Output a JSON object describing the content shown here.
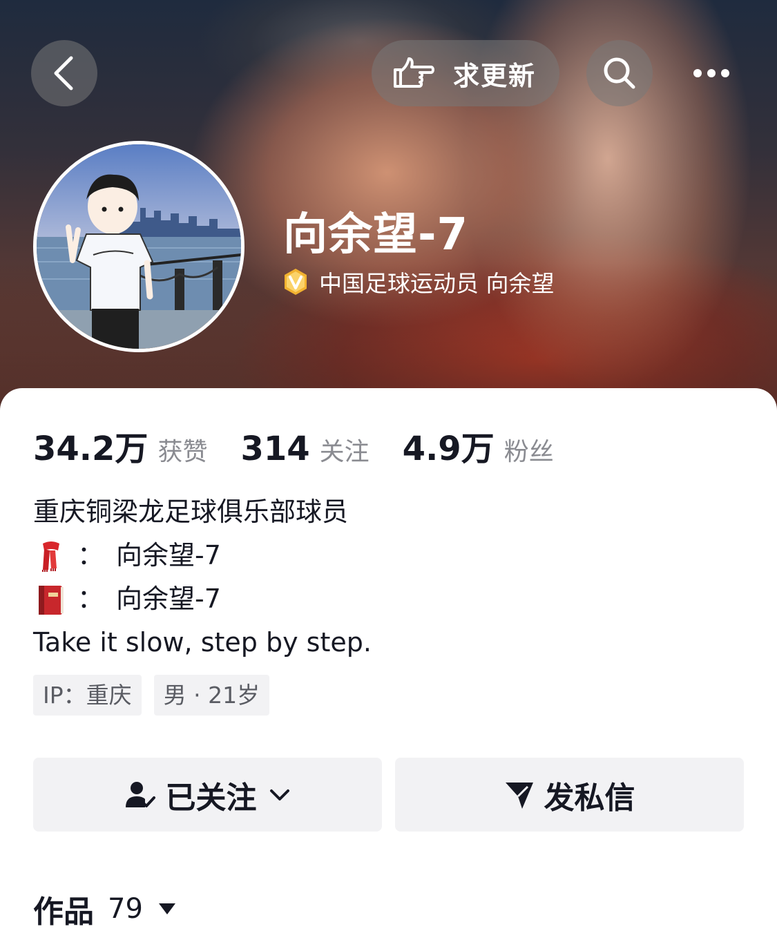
{
  "header": {
    "update_label": "求更新",
    "nickname": "向余望-7",
    "verify_text": "中国足球运动员 向余望",
    "verify_badge": "V"
  },
  "stats": [
    {
      "num": "34.2万",
      "label": "获赞"
    },
    {
      "num": "314",
      "label": "关注"
    },
    {
      "num": "4.9万",
      "label": "粉丝"
    }
  ],
  "bio": {
    "line1": "重庆铜梁龙足球俱乐部球员",
    "line2_colon": "：",
    "line2_text": "向余望-7",
    "line3_colon": "：",
    "line3_text": "向余望-7",
    "line4": "Take it slow, step by step."
  },
  "tags": [
    "IP：重庆",
    "男 · 21岁"
  ],
  "actions": {
    "follow_label": "已关注",
    "message_label": "发私信"
  },
  "works": {
    "label": "作品",
    "count": "79"
  },
  "icons": {
    "back": "back-arrow-icon",
    "update": "pointing-hand-icon",
    "search": "search-icon",
    "more": "more-dots-icon",
    "verify": "verified-badge-icon",
    "scarf": "scarf-emoji-icon",
    "book": "red-book-emoji-icon",
    "followed": "user-check-icon",
    "chevron": "chevron-down-icon",
    "send": "send-icon",
    "triangle": "triangle-down-icon"
  },
  "colors": {
    "verify_badge": "#f2b230",
    "stat_label": "#8a8b91",
    "tag_bg": "#f2f2f4"
  }
}
